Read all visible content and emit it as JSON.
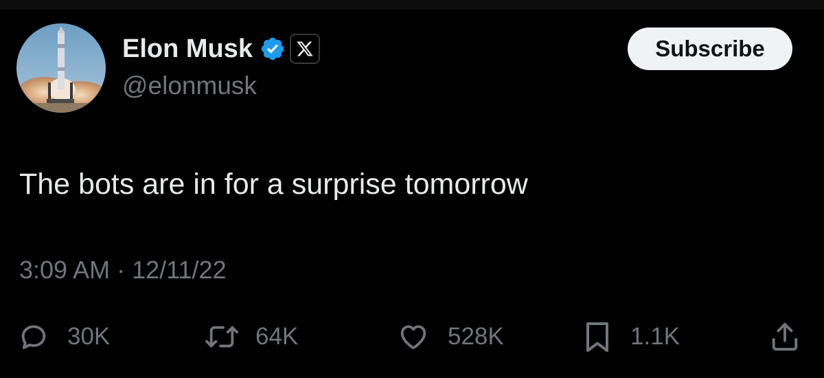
{
  "author": {
    "display_name": "Elon Musk",
    "handle": "@elonmusk",
    "verified_icon": "verified-badge-icon",
    "affiliation_icon": "x-logo-icon",
    "avatar": "rocket-launch-avatar"
  },
  "header": {
    "subscribe_label": "Subscribe"
  },
  "tweet": {
    "text": "The bots are in for a surprise tomorrow",
    "time": "3:09 AM",
    "separator": "·",
    "date": "12/11/22"
  },
  "actions": {
    "reply": {
      "icon": "reply-icon",
      "count": "30K"
    },
    "repost": {
      "icon": "repost-icon",
      "count": "64K"
    },
    "like": {
      "icon": "heart-icon",
      "count": "528K"
    },
    "bookmark": {
      "icon": "bookmark-icon",
      "count": "1.1K"
    },
    "share": {
      "icon": "share-icon"
    }
  },
  "colors": {
    "background": "#000000",
    "text_primary": "#e7e9ea",
    "text_secondary": "#71767b",
    "verified_blue": "#1d9bf0",
    "button_bg": "#eff3f4"
  }
}
